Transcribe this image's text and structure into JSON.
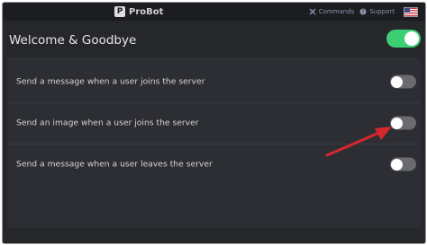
{
  "topbar": {
    "brand": "ProBot",
    "brand_logo_letter": "P",
    "commands_label": "Commands",
    "support_label": "Support",
    "flag_icon": "us-flag-icon"
  },
  "section": {
    "title": "Welcome & Goodbye",
    "enabled": true
  },
  "settings": [
    {
      "label": "Send a message when a user joins the server",
      "enabled": false
    },
    {
      "label": "Send an image when a user joins the server",
      "enabled": false
    },
    {
      "label": "Send a message when a user leaves the server",
      "enabled": false
    }
  ],
  "colors": {
    "accent_on": "#3ccf73",
    "toggle_off": "#6a6b70",
    "annotation_arrow": "#d8262e"
  }
}
